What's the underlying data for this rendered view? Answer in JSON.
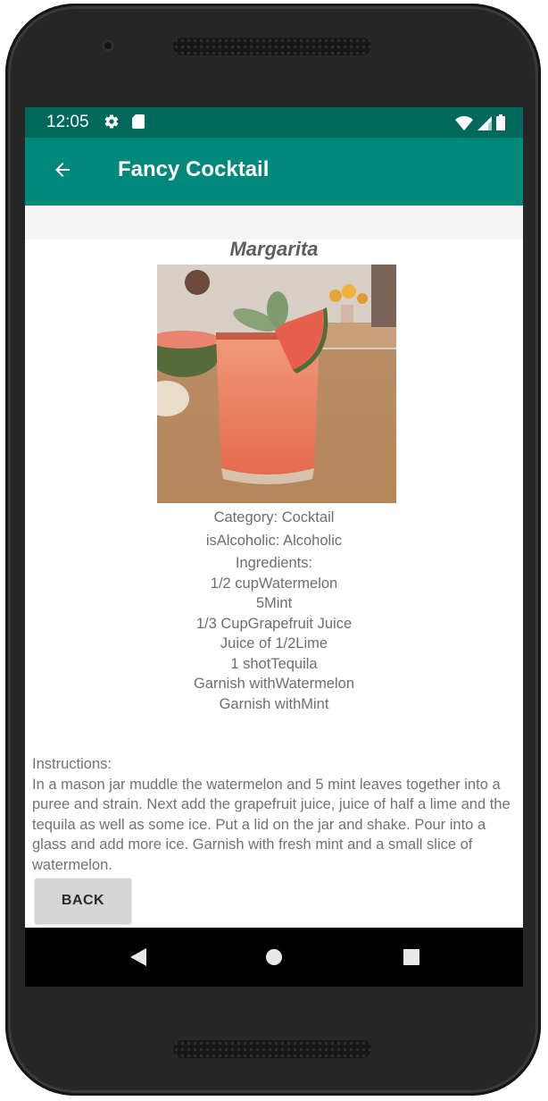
{
  "status_bar": {
    "time": "12:05",
    "icons": [
      "settings-gear-icon",
      "sd-card-icon",
      "wifi-icon",
      "signal-icon",
      "battery-icon"
    ]
  },
  "app_bar": {
    "title": "Fancy Cocktail",
    "back_icon": "arrow-back-icon",
    "color": "#00897b",
    "status_color": "#00695c"
  },
  "drink": {
    "name": "Margarita",
    "category": "Category: Cocktail",
    "alcoholic": "isAlcoholic: Alcoholic",
    "ingredients_heading": "Ingredients:",
    "ingredients": [
      "1/2 cupWatermelon",
      "5Mint",
      "1/3 CupGrapefruit Juice",
      "Juice of 1/2Lime",
      "1 shotTequila",
      "Garnish withWatermelon",
      "Garnish withMint"
    ],
    "instructions_heading": "Instructions:",
    "instructions": "In a mason jar muddle the watermelon and 5 mint leaves together into a puree and strain. Next add the grapefruit juice, juice of half a lime and the tequila as well as some ice. Put a lid on the jar and shake. Pour into a glass and add more ice. Garnish with fresh mint and a small slice of watermelon."
  },
  "buttons": {
    "back": "BACK"
  },
  "nav_bar": {
    "icons": [
      "nav-back-icon",
      "nav-home-icon",
      "nav-recents-icon"
    ]
  }
}
